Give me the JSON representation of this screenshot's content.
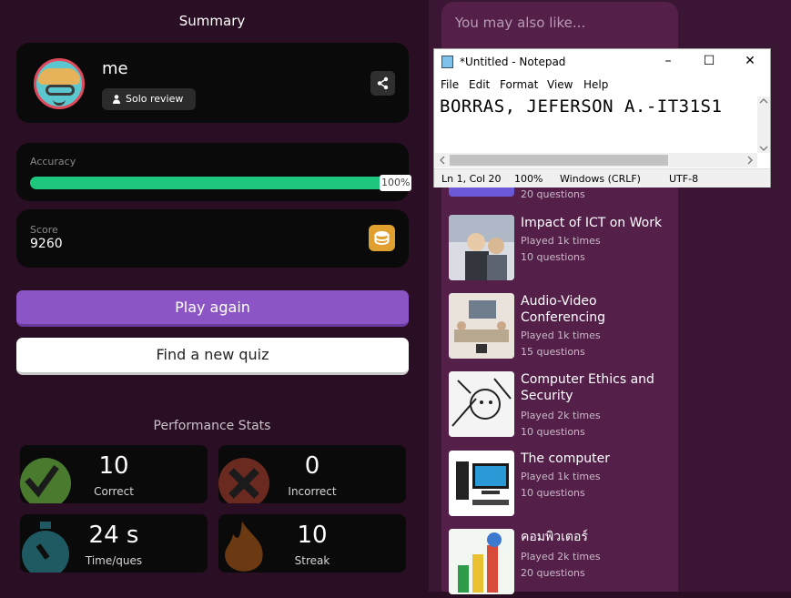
{
  "summary": {
    "title": "Summary"
  },
  "profile": {
    "name": "me",
    "mode": "Solo review"
  },
  "accuracy": {
    "label": "Accuracy",
    "value": 1.0,
    "display": "100%"
  },
  "score": {
    "label": "Score",
    "value": "9260"
  },
  "buttons": {
    "play_again": "Play again",
    "find_quiz": "Find a new quiz"
  },
  "performance": {
    "title": "Performance Stats",
    "stats": [
      {
        "value": "10",
        "label": "Correct",
        "icon": "checkmark-icon"
      },
      {
        "value": "0",
        "label": "Incorrect",
        "icon": "cross-icon"
      },
      {
        "value": "24 s",
        "label": "Time/ques",
        "icon": "stopwatch-icon"
      },
      {
        "value": "10",
        "label": "Streak",
        "icon": "flame-icon"
      }
    ]
  },
  "also_like": {
    "title": "You may also like...",
    "partial_item_sub": "20 questions",
    "items": [
      {
        "title": "Impact of ICT on Work",
        "played": "Played 1k times",
        "questions": "10 questions"
      },
      {
        "title": "Audio-Video Conferencing",
        "played": "Played 1k times",
        "questions": "15 questions"
      },
      {
        "title": "Computer Ethics and Security",
        "played": "Played 2k times",
        "questions": "10 questions"
      },
      {
        "title": "The computer",
        "played": "Played 1k times",
        "questions": "10 questions"
      },
      {
        "title": "คอมพิวเตอร์",
        "played": "Played 2k times",
        "questions": "20 questions"
      }
    ]
  },
  "notepad": {
    "title": "*Untitled - Notepad",
    "menu": [
      "File",
      "Edit",
      "Format",
      "View",
      "Help"
    ],
    "text": "BORRAS, JEFERSON A.-IT31S1",
    "status": {
      "position": "Ln 1, Col 20",
      "zoom": "100%",
      "line_ending": "Windows (CRLF)",
      "encoding": "UTF-8"
    }
  },
  "colors": {
    "accent_purple": "#8c55c6",
    "progress_green": "#1dc77d",
    "coin_gold": "#e0a030"
  }
}
